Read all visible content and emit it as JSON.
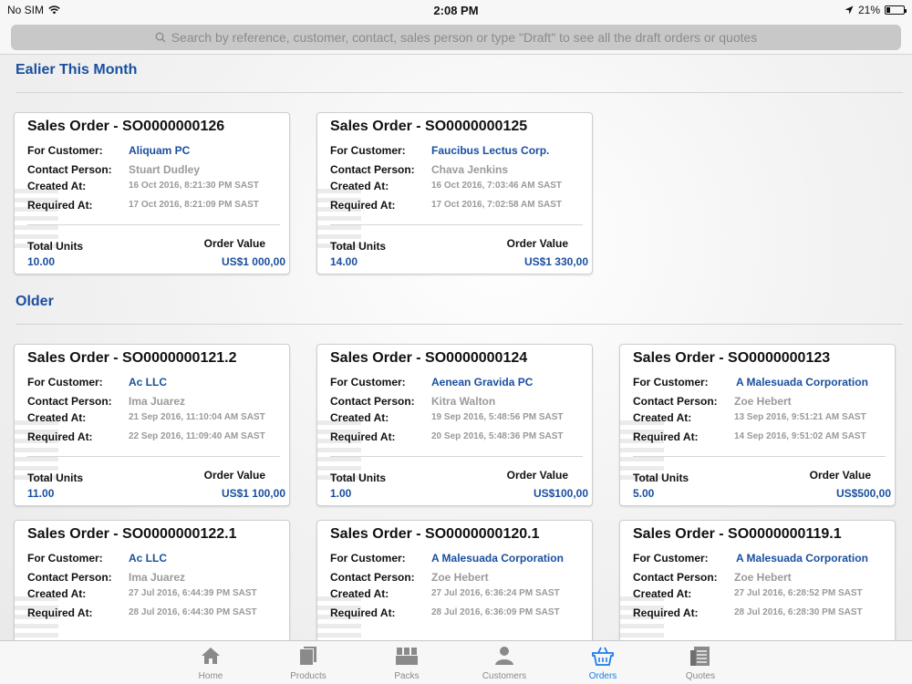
{
  "status": {
    "carrier": "No SIM",
    "time": "2:08 PM",
    "battery_text": "21%",
    "battery_fraction": 0.21
  },
  "search": {
    "placeholder": "Search by reference, customer, contact, sales person or type \"Draft\" to see all the draft orders or quotes"
  },
  "labels": {
    "for_customer": "For Customer:",
    "contact_person": "Contact Person:",
    "created_at": "Created At:",
    "required_at": "Required At:",
    "total_units": "Total Units",
    "order_value": "Order Value"
  },
  "sections": [
    {
      "title": "Ealier This Month",
      "orders": [
        {
          "title": "Sales Order - SO0000000126",
          "customer": "Aliquam PC",
          "contact": "Stuart Dudley",
          "created": "16 Oct 2016, 8:21:30 PM SAST",
          "required": "17 Oct 2016, 8:21:09 PM SAST",
          "units": "10.00",
          "value": "US$1 000,00"
        },
        {
          "title": "Sales Order - SO0000000125",
          "customer": "Faucibus Lectus Corp.",
          "contact": "Chava Jenkins",
          "created": "16 Oct 2016, 7:03:46 AM SAST",
          "required": "17 Oct 2016, 7:02:58 AM SAST",
          "units": "14.00",
          "value": "US$1 330,00"
        }
      ]
    },
    {
      "title": "Older",
      "orders": [
        {
          "title": "Sales Order - SO0000000121.2",
          "customer": "Ac LLC",
          "contact": "Ima Juarez",
          "created": "21 Sep 2016, 11:10:04 AM SAST",
          "required": "22 Sep 2016, 11:09:40 AM SAST",
          "units": "11.00",
          "value": "US$1 100,00"
        },
        {
          "title": "Sales Order - SO0000000124",
          "customer": "Aenean Gravida PC",
          "contact": "Kitra Walton",
          "created": "19 Sep 2016, 5:48:56 PM SAST",
          "required": "20 Sep 2016, 5:48:36 PM SAST",
          "units": "1.00",
          "value": "US$100,00"
        },
        {
          "title": "Sales Order - SO0000000123",
          "customer": "A Malesuada Corporation",
          "contact": "Zoe Hebert",
          "created": "13 Sep 2016, 9:51:21 AM SAST",
          "required": "14 Sep 2016, 9:51:02 AM SAST",
          "units": "5.00",
          "value": "US$500,00"
        },
        {
          "title": "Sales Order - SO0000000122.1",
          "customer": "Ac LLC",
          "contact": "Ima Juarez",
          "created": "27 Jul 2016, 6:44:39 PM SAST",
          "required": "28 Jul 2016, 6:44:30 PM SAST"
        },
        {
          "title": "Sales Order - SO0000000120.1",
          "customer": "A Malesuada Corporation",
          "contact": "Zoe Hebert",
          "created": "27 Jul 2016, 6:36:24 PM SAST",
          "required": "28 Jul 2016, 6:36:09 PM SAST"
        },
        {
          "title": "Sales Order - SO0000000119.1",
          "customer": "A Malesuada Corporation",
          "contact": "Zoe Hebert",
          "created": "27 Jul 2016, 6:28:52 PM SAST",
          "required": "28 Jul 2016, 6:28:30 PM SAST"
        }
      ]
    }
  ],
  "tabs": [
    {
      "label": "Home",
      "icon": "home-icon",
      "active": false
    },
    {
      "label": "Products",
      "icon": "products-icon",
      "active": false
    },
    {
      "label": "Packs",
      "icon": "packs-icon",
      "active": false
    },
    {
      "label": "Customers",
      "icon": "customers-icon",
      "active": false
    },
    {
      "label": "Orders",
      "icon": "orders-basket-icon",
      "active": true
    },
    {
      "label": "Quotes",
      "icon": "quotes-icon",
      "active": false
    }
  ],
  "colors": {
    "accent": "#1a4fa0",
    "tab_active": "#1b7cf0",
    "tab_inactive": "#8a8a8a"
  }
}
